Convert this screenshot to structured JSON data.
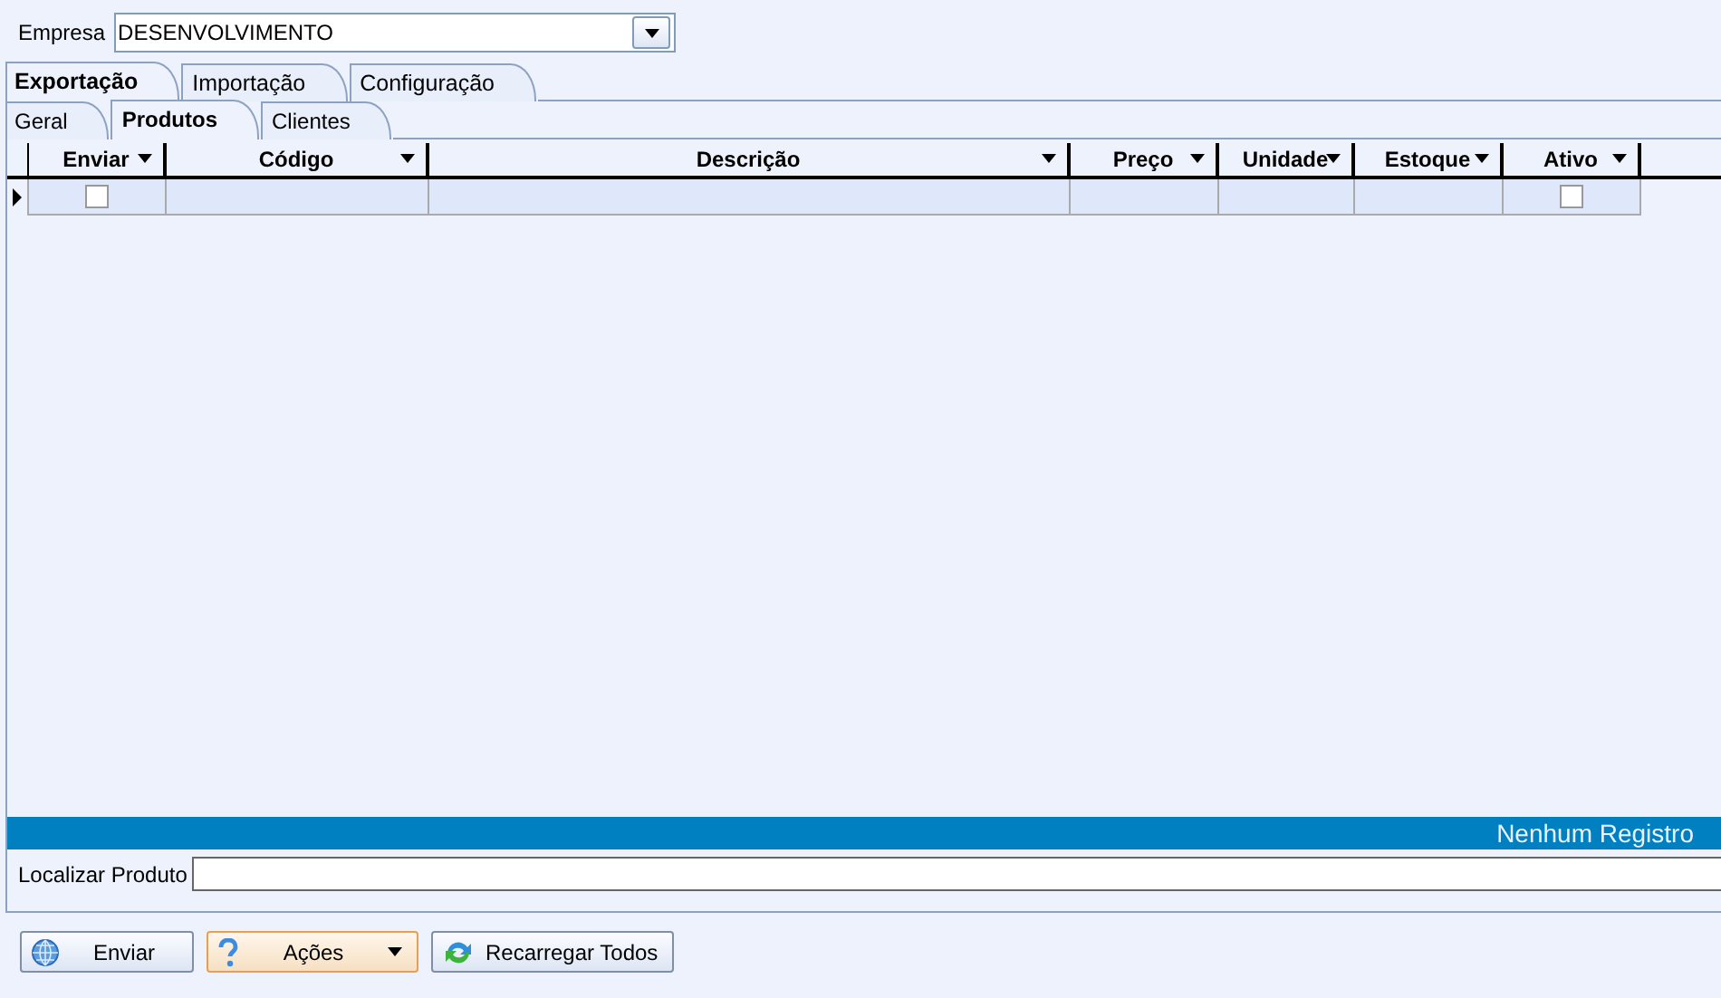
{
  "company": {
    "label": "Empresa",
    "value": "DESENVOLVIMENTO"
  },
  "tabs": [
    {
      "label": "Exportação",
      "selected": true
    },
    {
      "label": "Importação",
      "selected": false
    },
    {
      "label": "Configuração",
      "selected": false
    }
  ],
  "subtabs": [
    {
      "label": "Geral",
      "selected": false
    },
    {
      "label": "Produtos",
      "selected": true
    },
    {
      "label": "Clientes",
      "selected": false
    }
  ],
  "table": {
    "columns": [
      {
        "label": "Enviar",
        "kind": "check"
      },
      {
        "label": "Código",
        "kind": "text"
      },
      {
        "label": "Descrição",
        "kind": "text"
      },
      {
        "label": "Preço",
        "kind": "text"
      },
      {
        "label": "Unidade",
        "kind": "text"
      },
      {
        "label": "Estoque",
        "kind": "text"
      },
      {
        "label": "Ativo",
        "kind": "check"
      }
    ],
    "rows": [
      {
        "current": true,
        "cells": [
          {
            "checked": false
          },
          {},
          {},
          {},
          {},
          {},
          {
            "checked": false
          }
        ]
      }
    ]
  },
  "status_bar": {
    "text": "Nenhum Registro"
  },
  "search": {
    "label": "Localizar Produto"
  },
  "buttons": [
    {
      "label": "Enviar",
      "dropdown": false,
      "focused": false
    },
    {
      "label": "Ações",
      "dropdown": true,
      "focused": true
    },
    {
      "label": "Recarregar Todos",
      "dropdown": false,
      "focused": false
    }
  ]
}
